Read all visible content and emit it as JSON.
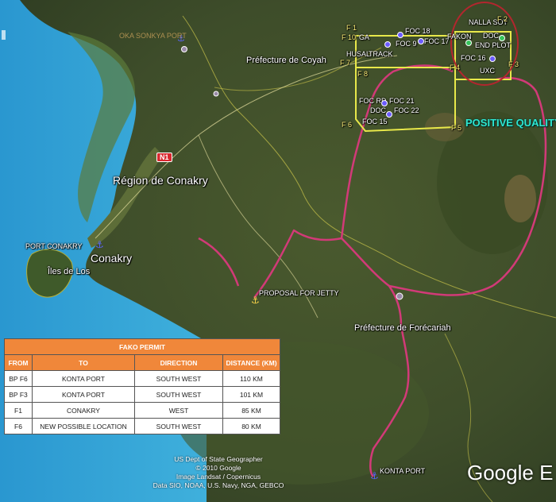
{
  "labels": {
    "sonkya": "OKA SONKYA PORT",
    "prefecture_coyah": "Préfecture de Coyah",
    "region_conakry": "Région de Conakry",
    "road_badge": "N1",
    "port_conakry": "PORT CONAKRY",
    "conakry": "Conakry",
    "iles_de_los": "Îles de Los",
    "proposal_jetty": "PROPOSAL FOR JETTY",
    "prefecture_forecariah": "Préfecture de Forécariah",
    "konta_port": "KONTA PORT",
    "positive_quality": "POSITIVE QUALITY",
    "f1": "F 1",
    "f10": "F 10",
    "f7": "F 7",
    "f8": "F 8",
    "f4": "F 4",
    "f6": "F 6",
    "f5": "F 5",
    "f3": "F 3",
    "f2": "F 2",
    "ga": "GA",
    "husal": "HUSAL",
    "track": "TRACK",
    "foc18": "FOC 18",
    "foc9": "FOC 9",
    "foc17": "FOC 17",
    "foc16": "FOC 16",
    "foc21": "FOC 21",
    "foc15": "FOC 15",
    "foc22": "FOC 22",
    "foc_rd": "FOC RD",
    "nalla_sot": "NALLA SOT",
    "end_plot": "END PLOT",
    "fakon": "FAKON",
    "doc": "DOC",
    "doc2": "DOC",
    "uxc": "UXC"
  },
  "table": {
    "title": "FAKO PERMIT",
    "headers": [
      "FROM",
      "TO",
      "DIRECTION",
      "DISTANCE (KM)"
    ],
    "rows": [
      [
        "BP F6",
        "KONTA PORT",
        "SOUTH WEST",
        "110 KM"
      ],
      [
        "BP F3",
        "KONTA PORT",
        "SOUTH WEST",
        "101 KM"
      ],
      [
        "F1",
        "CONAKRY",
        "WEST",
        "85 KM"
      ],
      [
        "F6",
        "NEW POSSIBLE LOCATION",
        "SOUTH WEST",
        "80 KM"
      ]
    ]
  },
  "credits": {
    "line1": "US Dept of State Geographer",
    "line2": "© 2010 Google",
    "line3": "Image Landsat / Copernicus",
    "line4": "Data SIO, NOAA, U.S. Navy, NGA, GEBCO"
  },
  "logo_text": "Google E",
  "colors": {
    "ocean": "#3aa9d8",
    "route": "#d23a78",
    "permit_outline": "#e8e84a",
    "highlight_circle": "#b3262e",
    "quality_text": "#2ee6d0",
    "table_header": "#f0873a"
  }
}
